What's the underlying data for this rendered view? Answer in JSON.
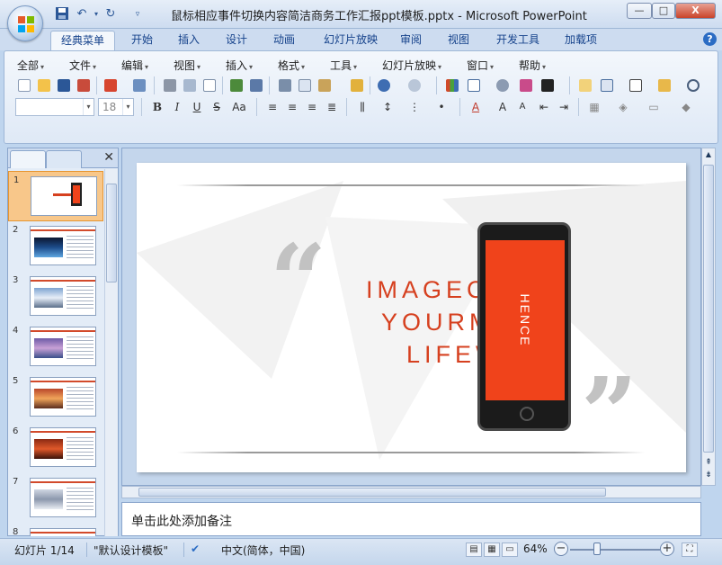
{
  "window": {
    "title": "鼠标相应事件切换内容简洁商务工作汇报ppt模板.pptx - Microsoft PowerPoint",
    "min_label": "—",
    "max_label": "□",
    "close_label": "X"
  },
  "qat": {
    "save_icon": "save-icon",
    "undo_icon": "undo-icon",
    "redo_icon": "redo-icon",
    "customize_icon": "customize-icon"
  },
  "ribbon_tabs": [
    "经典菜单",
    "开始",
    "插入",
    "设计",
    "动画",
    "幻灯片放映",
    "审阅",
    "视图",
    "开发工具",
    "加载项"
  ],
  "menu": [
    "全部",
    "文件",
    "编辑",
    "视图",
    "插入",
    "格式",
    "工具",
    "幻灯片放映",
    "窗口",
    "帮助"
  ],
  "font": {
    "name": "",
    "size": "18"
  },
  "format_buttons": [
    "B",
    "I",
    "U",
    "S",
    "Aa"
  ],
  "slide_thumbnails": [
    "1",
    "2",
    "3",
    "4",
    "5",
    "6",
    "7",
    "8"
  ],
  "slide": {
    "line1": "IMAGEC      ECT",
    "line2": "YOURM",
    "line3": "LIFEW      D",
    "quote_open": "“",
    "quote_close": "”",
    "phone_text": "HENCE"
  },
  "notes_placeholder": "单击此处添加备注",
  "status": {
    "slide_count": "幻灯片 1/14",
    "theme": "\"默认设计模板\"",
    "language": "中文(简体，中国)",
    "zoom": "64%"
  },
  "colors": {
    "accent": "#d6401f",
    "phone_screen": "#f0431b",
    "ribbon": "#dfe9f6"
  }
}
